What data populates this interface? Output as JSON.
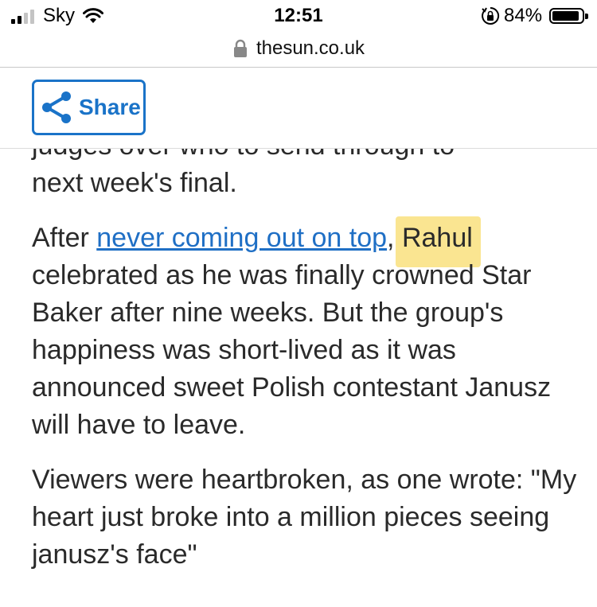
{
  "status_bar": {
    "carrier": "Sky",
    "time": "12:51",
    "battery_percent": "84%",
    "battery_level": 0.84,
    "signal_bars": 2
  },
  "browser": {
    "url": "thesun.co.uk"
  },
  "toolbar": {
    "share_label": "Share"
  },
  "article": {
    "cut_line": "judges over who to send through to",
    "p1_line2": "next week's final.",
    "p2_start": "After ",
    "p2_link": "never coming out on top",
    "p2_comma": ", ",
    "p2_name": "Rahul",
    "p2_rest": " celebrated as he was finally crowned Star Baker after nine weeks. But the group's happiness was short-lived as it was announced sweet Polish contestant Janusz will have to leave.",
    "p3": "Viewers were heartbroken, as one wrote: \"My heart just broke into a million pieces seeing janusz's face\""
  },
  "colors": {
    "link": "#1f6fc5",
    "share_accent": "#1a73c8",
    "highlight": "#f7d448"
  }
}
